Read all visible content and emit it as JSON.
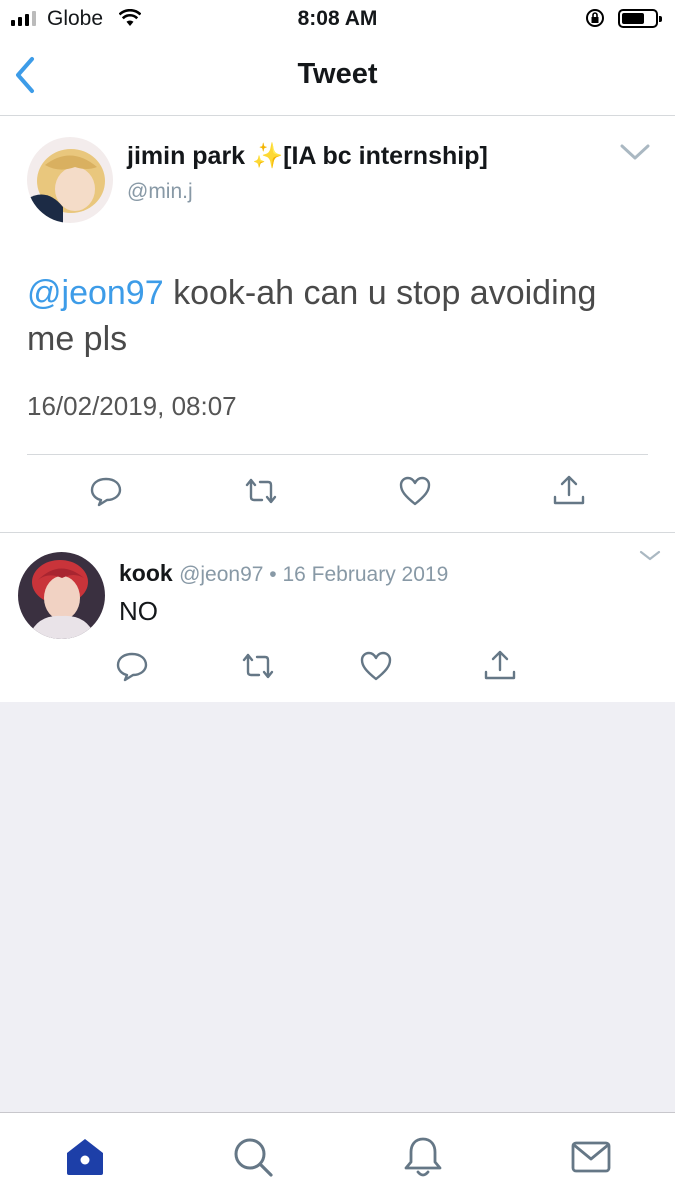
{
  "status_bar": {
    "carrier": "Globe",
    "time": "8:08 AM",
    "battery_level": 0.6
  },
  "nav": {
    "title": "Tweet",
    "back_icon": "chevron-left-icon"
  },
  "main_tweet": {
    "author_name": "jimin park ✨[IA bc internship]",
    "author_handle": "@min.j",
    "mention": "@jeon97",
    "text": " kook-ah can u stop avoiding me pls",
    "timestamp": "16/02/2019, 08:07",
    "actions": [
      "reply-icon",
      "retweet-icon",
      "like-icon",
      "share-icon"
    ]
  },
  "reply": {
    "author_name": "kook",
    "meta": "@jeon97 • 16 February 2019",
    "text": "NO",
    "actions": [
      "reply-icon",
      "retweet-icon",
      "like-icon",
      "share-icon"
    ]
  },
  "tab_bar": {
    "tabs": [
      "home-icon",
      "search-icon",
      "notifications-icon",
      "messages-icon"
    ],
    "active_color": "#1d3fa8",
    "inactive_color": "#657786"
  },
  "colors": {
    "accent": "#1da1f2",
    "mention": "#3d9ce8",
    "secondary_text": "#8899a6",
    "divider": "#d6d9dc",
    "background_empty": "#efeff4"
  }
}
